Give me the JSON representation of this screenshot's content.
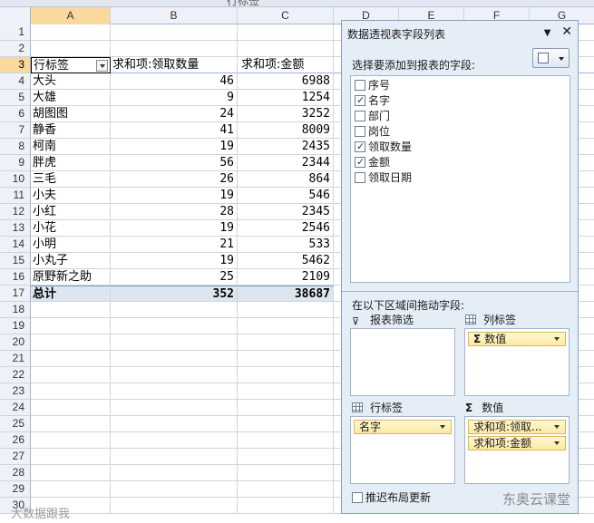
{
  "formula_bar_text": "行标签",
  "columns": [
    "A",
    "B",
    "C",
    "D",
    "E",
    "F",
    "G"
  ],
  "selected_column": "A",
  "rows": [
    "1",
    "2",
    "3",
    "4",
    "5",
    "6",
    "7",
    "8",
    "9",
    "10",
    "11",
    "12",
    "13",
    "14",
    "15",
    "16",
    "17",
    "18",
    "19",
    "20",
    "21",
    "22",
    "23",
    "24",
    "25",
    "26",
    "27",
    "28",
    "29",
    "30"
  ],
  "selected_row": "3",
  "pivot": {
    "header": {
      "row_labels": "行标签",
      "col_b": "求和项:领取数量",
      "col_c": "求和项:金额"
    },
    "records": [
      {
        "name": "大头",
        "qty": "46",
        "amount": "6988"
      },
      {
        "name": "大雄",
        "qty": "9",
        "amount": "1254"
      },
      {
        "name": "胡图图",
        "qty": "24",
        "amount": "3252"
      },
      {
        "name": "静香",
        "qty": "41",
        "amount": "8009"
      },
      {
        "name": "柯南",
        "qty": "19",
        "amount": "2435"
      },
      {
        "name": "胖虎",
        "qty": "56",
        "amount": "2344"
      },
      {
        "name": "三毛",
        "qty": "26",
        "amount": "864"
      },
      {
        "name": "小夫",
        "qty": "19",
        "amount": "546"
      },
      {
        "name": "小红",
        "qty": "28",
        "amount": "2345"
      },
      {
        "name": "小花",
        "qty": "19",
        "amount": "2546"
      },
      {
        "name": "小明",
        "qty": "21",
        "amount": "533"
      },
      {
        "name": "小丸子",
        "qty": "19",
        "amount": "5462"
      },
      {
        "name": "原野新之助",
        "qty": "25",
        "amount": "2109"
      }
    ],
    "total": {
      "label": "总计",
      "qty": "352",
      "amount": "38687"
    }
  },
  "field_list": {
    "title": "数据透视表字段列表",
    "choose_label": "选择要添加到报表的字段:",
    "fields": [
      {
        "label": "序号",
        "checked": false
      },
      {
        "label": "名字",
        "checked": true
      },
      {
        "label": "部门",
        "checked": false
      },
      {
        "label": "岗位",
        "checked": false
      },
      {
        "label": "领取数量",
        "checked": true
      },
      {
        "label": "金额",
        "checked": true
      },
      {
        "label": "领取日期",
        "checked": false
      }
    ],
    "drag_label": "在以下区域间拖动字段:",
    "report_filter_label": "报表筛选",
    "column_labels_label": "列标签",
    "row_labels_label": "行标签",
    "values_label": "数值",
    "column_chip": "数值",
    "row_chip": "名字",
    "value_chips": [
      "求和项:领取...",
      "求和项:金额"
    ],
    "defer_label": "推迟布局更新",
    "defer_checked": false
  },
  "watermarks": {
    "left": "大数据跟我",
    "right": "东奥云课堂"
  }
}
